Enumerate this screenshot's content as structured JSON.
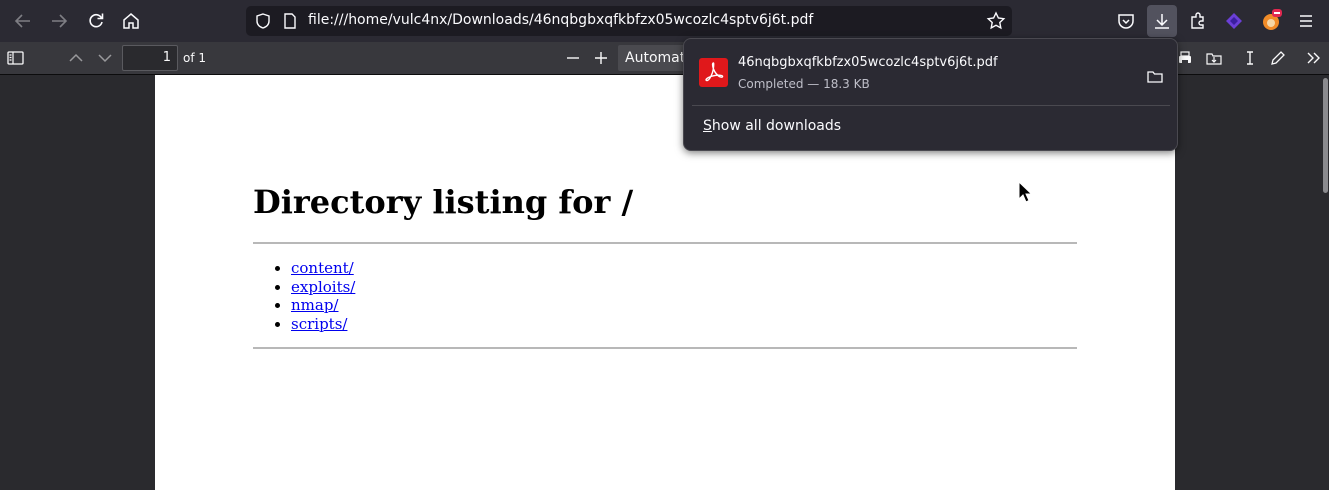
{
  "browser": {
    "url": "file:///home/vulc4nx/Downloads/46nqbgbxqfkbfzx05wcozlc4sptv6j6t.pdf",
    "nav_icons": [
      "back-icon",
      "forward-icon",
      "reload-icon",
      "home-icon"
    ],
    "url_icons": [
      "shield-icon",
      "page-icon",
      "star-icon"
    ],
    "toolbar_icons": [
      "pocket-icon",
      "download-icon",
      "extensions-icon",
      "extension-purple-icon",
      "extension-fox-icon",
      "menu-icon"
    ]
  },
  "pdf_toolbar": {
    "page_number": "1",
    "page_count": "of 1",
    "zoom": "Automatic Zoom"
  },
  "document": {
    "title": "Directory listing for /",
    "links": [
      "content/",
      "exploits/",
      "nmap/",
      "scripts/"
    ]
  },
  "downloads_panel": {
    "file_name": "46nqbgbxqfkbfzx05wcozlc4sptv6j6t.pdf",
    "status": "Completed — 18.3 KB",
    "show_all_accel": "S",
    "show_all_rest": "how all downloads"
  },
  "colors": {
    "link": "#0000ee",
    "pdf_red": "#e0181b",
    "toolbar_bg": "#2b2a33"
  }
}
